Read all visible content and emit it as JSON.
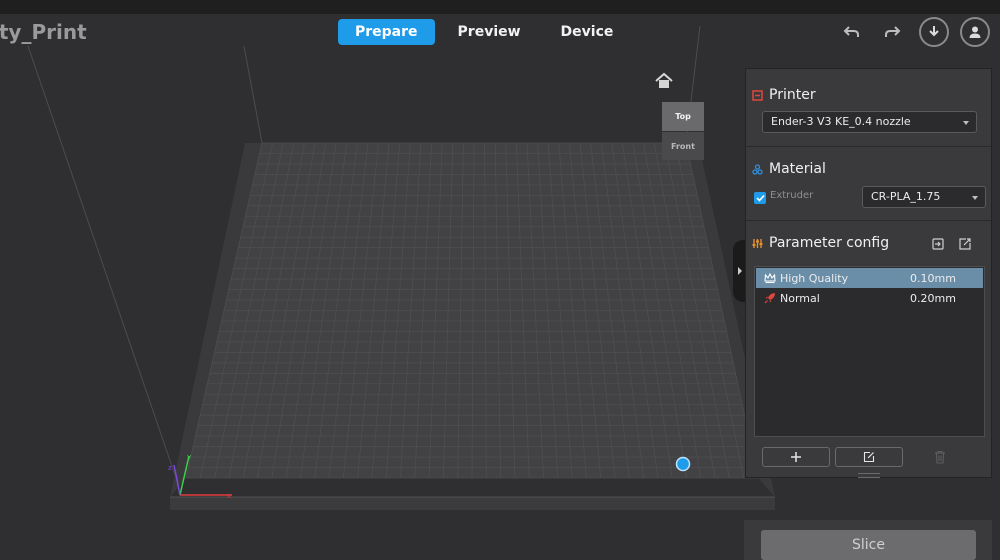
{
  "header": {
    "project_title": "ity_Print",
    "tabs": [
      {
        "label": "Prepare",
        "active": true
      },
      {
        "label": "Preview",
        "active": false
      },
      {
        "label": "Device",
        "active": false
      }
    ]
  },
  "viewcube": {
    "top_label": "Top",
    "front_label": "Front"
  },
  "printer": {
    "heading": "Printer",
    "selected": "Ender-3 V3 KE_0.4 nozzle"
  },
  "material": {
    "heading": "Material",
    "extruder_label": "Extruder",
    "extruder_checked": true,
    "selected": "CR-PLA_1.75"
  },
  "parameter_config": {
    "heading": "Parameter config",
    "profiles": [
      {
        "name": "High Quality",
        "value": "0.10mm",
        "selected": true,
        "icon": "crown-icon"
      },
      {
        "name": "Normal",
        "value": "0.20mm",
        "selected": false,
        "icon": "rocket-icon"
      }
    ]
  },
  "slice": {
    "label": "Slice"
  },
  "colors": {
    "accent": "#1e9be9",
    "printer_icon": "#e0463c",
    "material_icon": "#2f8fe0",
    "param_icon": "#e8902a",
    "axis_x": "#e23a3a",
    "axis_y": "#3ad24a",
    "axis_z": "#7a4adf"
  }
}
